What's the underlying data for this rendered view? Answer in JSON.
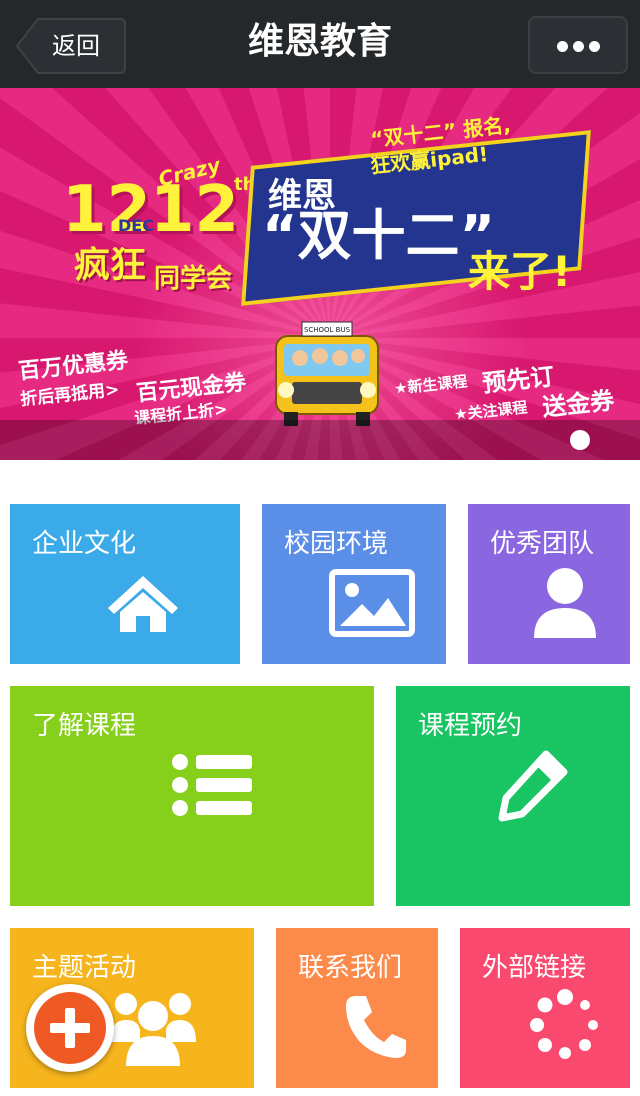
{
  "header": {
    "back_label": "返回",
    "title": "维恩教育"
  },
  "banner": {
    "num_left": "12",
    "num_right": "12",
    "crazy": "Crazy",
    "dec": "DEC",
    "th": "th",
    "crazy_cn": "疯狂",
    "classmate": "同学会",
    "weien": "维恩",
    "double12_quote": "“双十二”",
    "double12": "“双十二”",
    "coming": "来了!",
    "signup_1": "“双十二” 报名,",
    "signup_2": "狂欢赢ipad!",
    "million": "百万优惠券",
    "deduct": "折后再抵用>",
    "hundred": "百元现金券",
    "course_off": "课程折上折>",
    "new_course": "★新生课程",
    "reserve": "预先订",
    "follow": "★关注课程",
    "voucher": "送金券",
    "bus_sign": "SCHOOL BUS",
    "slide_count": 1
  },
  "tiles": [
    {
      "label": "企业文化",
      "icon": "house-icon",
      "color": "#3aabe8"
    },
    {
      "label": "校园环境",
      "icon": "picture-icon",
      "color": "#5b8ee6"
    },
    {
      "label": "优秀团队",
      "icon": "person-icon",
      "color": "#8a66e0"
    },
    {
      "label": "了解课程",
      "icon": "list-icon",
      "color": "#86cf1a"
    },
    {
      "label": "课程预约",
      "icon": "pencil-icon",
      "color": "#19c462"
    },
    {
      "label": "主题活动",
      "icon": "group-icon",
      "color": "#f6b51d"
    },
    {
      "label": "联系我们",
      "icon": "phone-icon",
      "color": "#fb8a4b"
    },
    {
      "label": "外部链接",
      "icon": "loading-spinner-icon",
      "color": "#f9496e"
    }
  ],
  "fab": {
    "icon": "plus-icon",
    "color": "#ef5a24"
  }
}
